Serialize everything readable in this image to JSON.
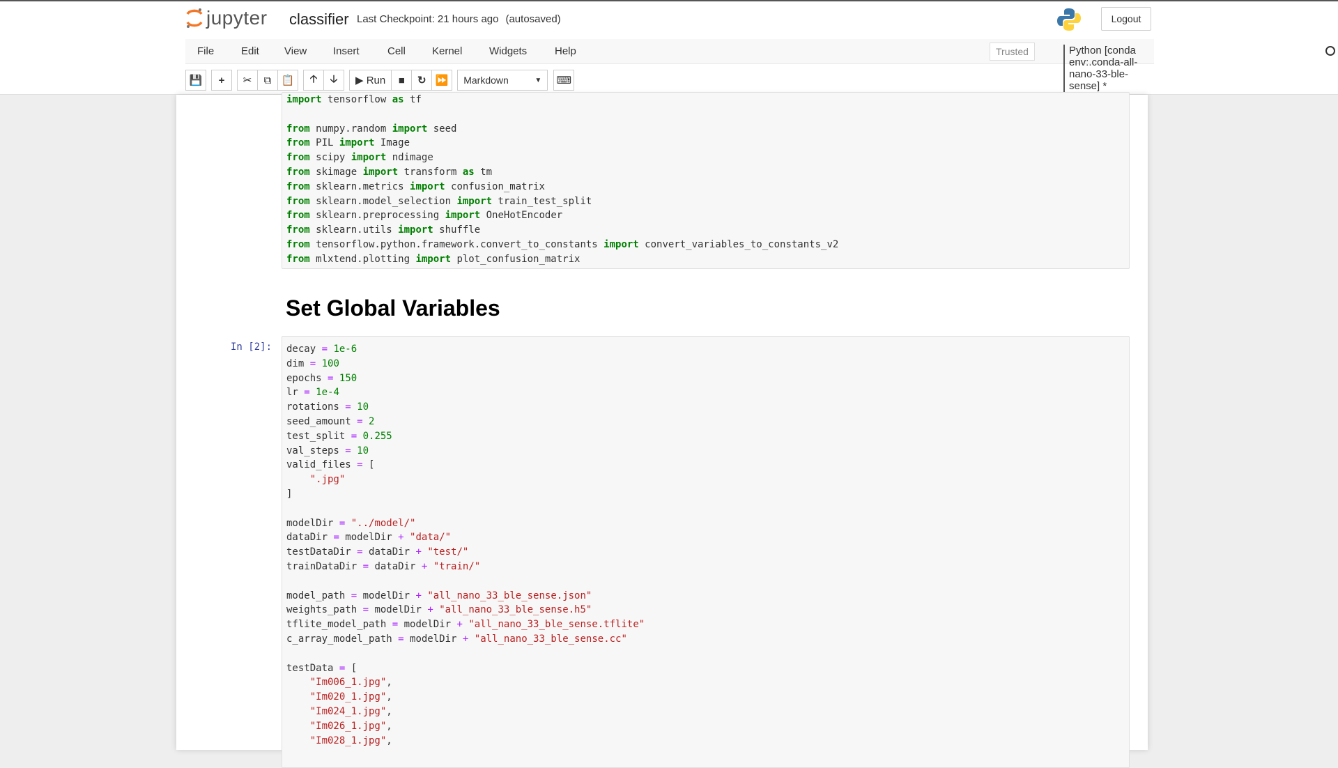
{
  "header": {
    "logo_text": "jupyter",
    "notebook_name": "classifier",
    "checkpoint": "Last Checkpoint: 21 hours ago",
    "autosaved": "(autosaved)",
    "logout": "Logout"
  },
  "menu": {
    "items": [
      "File",
      "Edit",
      "View",
      "Insert",
      "Cell",
      "Kernel",
      "Widgets",
      "Help"
    ],
    "trusted": "Trusted",
    "kernel": "Python [conda env:.conda-all-nano-33-ble-sense] *"
  },
  "toolbar": {
    "run": "Run",
    "cell_type": "Markdown",
    "icons": [
      "save-icon",
      "plus-icon",
      "cut-icon",
      "copy-icon",
      "paste-icon",
      "arrow-up-icon",
      "arrow-down-icon",
      "run-icon",
      "stop-icon",
      "restart-icon",
      "fast-forward-icon",
      "keyboard-icon"
    ]
  },
  "cells": [
    {
      "prompt": "",
      "lines": [
        "import tensorflow as tf",
        "",
        "from numpy.random import seed",
        "from PIL import Image",
        "from scipy import ndimage",
        "from skimage import transform as tm",
        "from sklearn.metrics import confusion_matrix",
        "from sklearn.model_selection import train_test_split",
        "from sklearn.preprocessing import OneHotEncoder",
        "from sklearn.utils import shuffle",
        "from tensorflow.python.framework.convert_to_constants import convert_variables_to_constants_v2",
        "from mlxtend.plotting import plot_confusion_matrix"
      ]
    },
    {
      "heading": "Set Global Variables"
    },
    {
      "prompt": "In [2]:",
      "lines": [
        "decay = 1e-6",
        "dim = 100",
        "epochs = 150",
        "lr = 1e-4",
        "rotations = 10",
        "seed_amount = 2",
        "test_split = 0.255",
        "val_steps = 10",
        "valid_files = [",
        "    \".jpg\"",
        "]",
        "",
        "modelDir = \"../model/\"",
        "dataDir = modelDir + \"data/\"",
        "testDataDir = dataDir + \"test/\"",
        "trainDataDir = dataDir + \"train/\"",
        "",
        "model_path = modelDir + \"all_nano_33_ble_sense.json\"",
        "weights_path = modelDir + \"all_nano_33_ble_sense.h5\"",
        "tflite_model_path = modelDir + \"all_nano_33_ble_sense.tflite\"",
        "c_array_model_path = modelDir + \"all_nano_33_ble_sense.cc\"",
        "",
        "testData = [",
        "    \"Im006_1.jpg\",",
        "    \"Im020_1.jpg\",",
        "    \"Im024_1.jpg\",",
        "    \"Im026_1.jpg\",",
        "    \"Im028_1.jpg\","
      ]
    }
  ]
}
